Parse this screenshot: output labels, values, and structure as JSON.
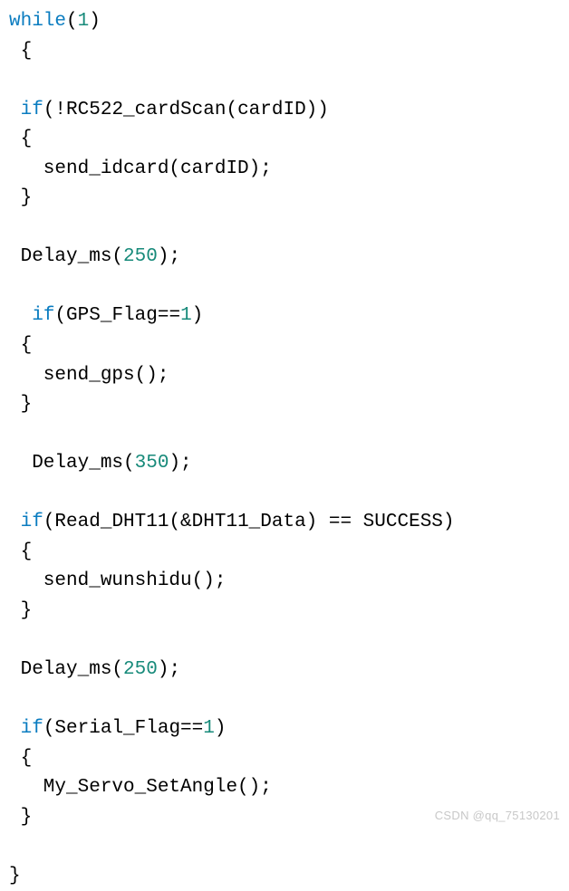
{
  "code": {
    "kw_while": "while",
    "kw_if": "if",
    "num_1": "1",
    "num_250a": "250",
    "num_350": "350",
    "num_250b": "250",
    "num_gpsflag": "1",
    "num_serialflag": "1",
    "t_lparen1": "(",
    "t_rparen1": ")",
    "t_lbrace1": " {",
    "t_if_card": "(!RC522_cardScan(cardID))",
    "t_lbrace2": " {",
    "t_send_idcard": "   send_idcard(cardID);",
    "t_rbrace2": " }",
    "t_delay1a": " Delay_ms(",
    "t_delay1b": ");",
    "t_if_gps_a": "(GPS_Flag==",
    "t_if_gps_b": ")",
    "t_lbrace3": " {",
    "t_send_gps": "   send_gps();",
    "t_rbrace3": " }",
    "t_delay2a": "  Delay_ms(",
    "t_delay2b": ");",
    "t_if_dht": "(Read_DHT11(&DHT11_Data) == SUCCESS)",
    "t_lbrace4": " {",
    "t_send_wsd": "   send_wunshidu();",
    "t_rbrace4": " }",
    "t_delay3a": " Delay_ms(",
    "t_delay3b": ");",
    "t_if_serial_a": "(Serial_Flag==",
    "t_if_serial_b": ")",
    "t_lbrace5": " {",
    "t_servo": "   My_Servo_SetAngle();",
    "t_rbrace5": " }",
    "t_rbrace1": "}"
  },
  "watermark": "CSDN @qq_75130201"
}
